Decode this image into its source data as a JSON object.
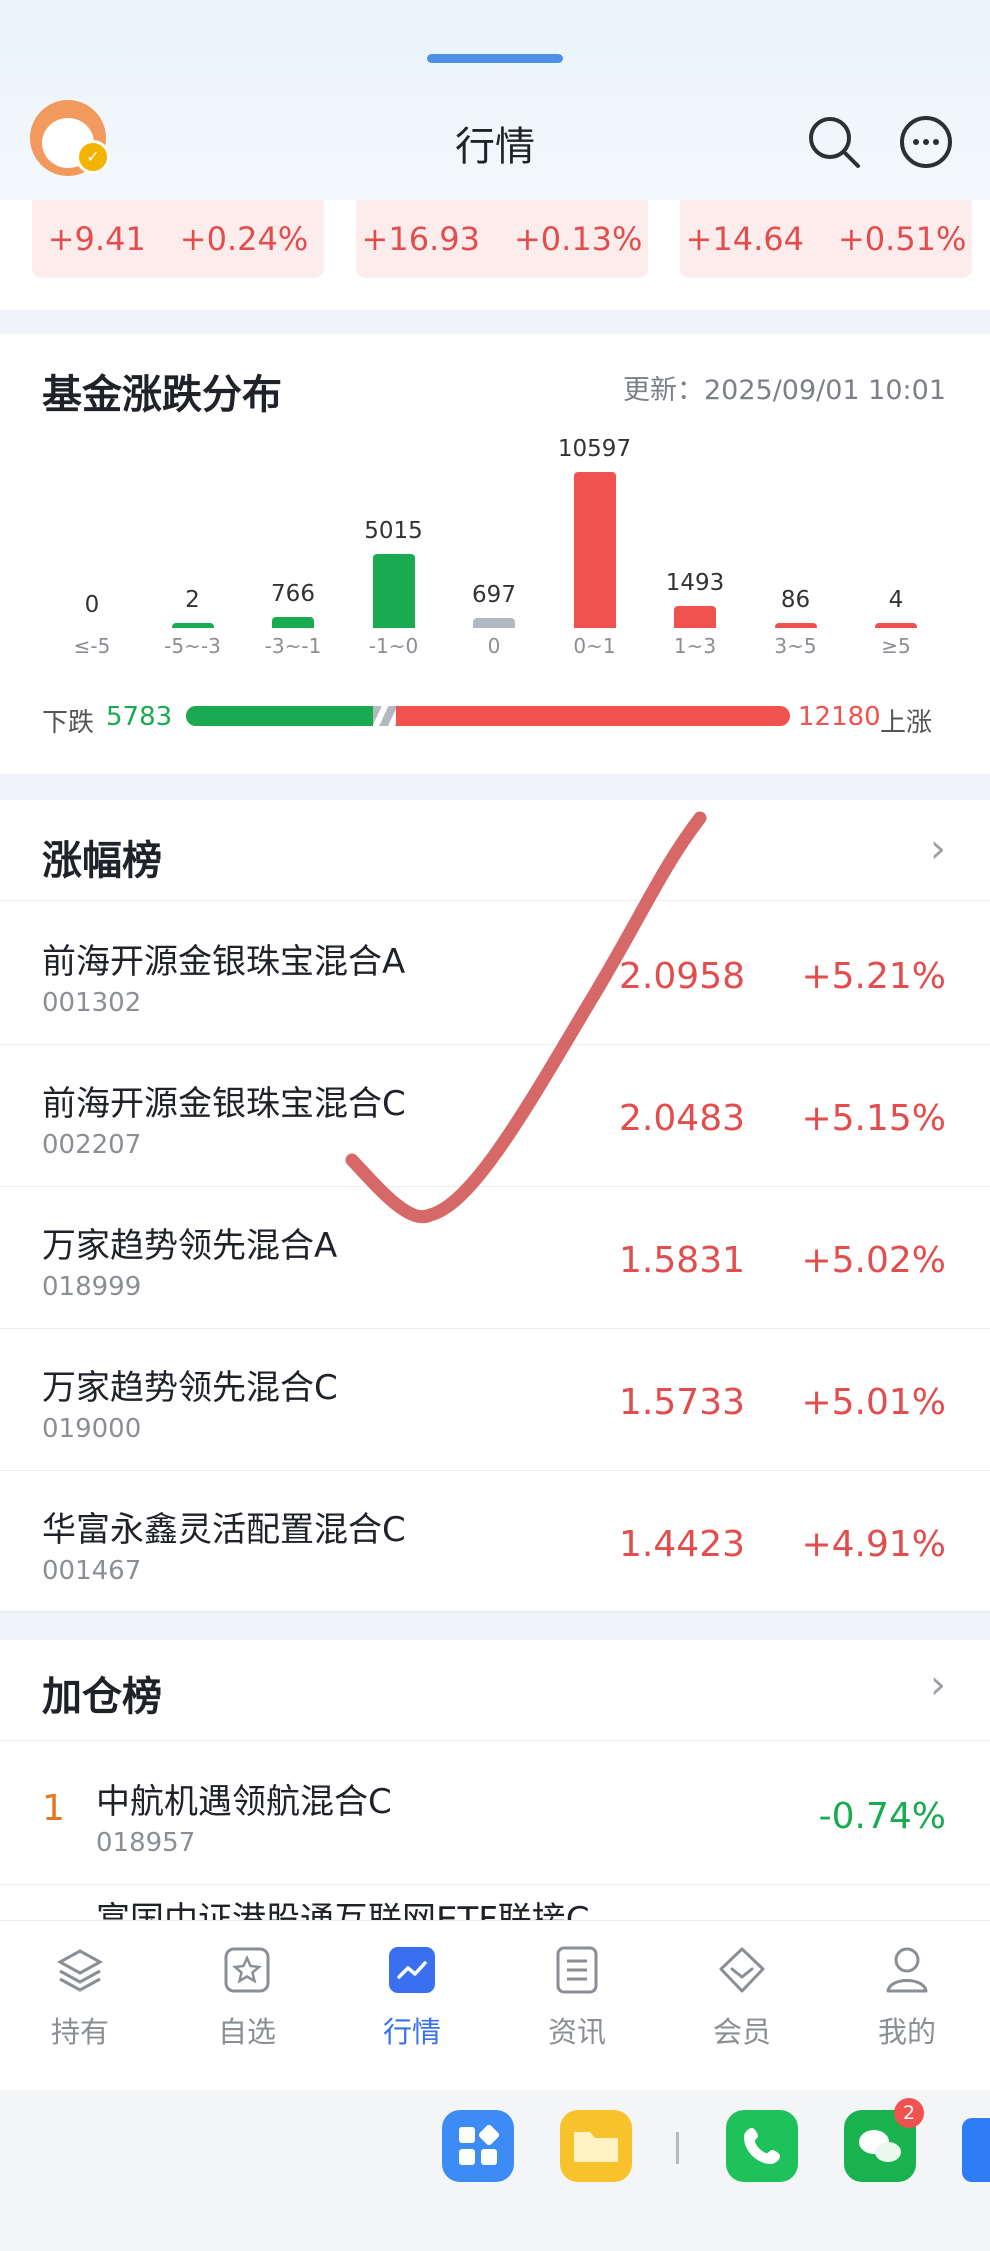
{
  "header": {
    "title": "行情"
  },
  "indices": [
    {
      "change": "+9.41",
      "pct": "+0.24%"
    },
    {
      "change": "+16.93",
      "pct": "+0.13%"
    },
    {
      "change": "+14.64",
      "pct": "+0.51%"
    }
  ],
  "distribution": {
    "title": "基金涨跌分布",
    "updated": "更新：2025/09/01 10:01",
    "down_label": "下跌",
    "down_count": "5783",
    "up_label": "上涨",
    "up_count": "12180",
    "colors": {
      "down": "#1aab52",
      "flat": "#b3b9c2",
      "up": "#f0524f"
    }
  },
  "chart_data": {
    "type": "bar",
    "categories": [
      "≤-5",
      "-5~-3",
      "-3~-1",
      "-1~0",
      "0",
      "0~1",
      "1~3",
      "3~5",
      "≥5"
    ],
    "values": [
      0,
      2,
      766,
      5015,
      697,
      10597,
      1493,
      86,
      4
    ],
    "value_labels": [
      "0",
      "2",
      "766",
      "5015",
      "697",
      "10597",
      "1493",
      "86",
      "4"
    ],
    "bar_colors": [
      "#1aab52",
      "#1aab52",
      "#1aab52",
      "#1aab52",
      "#b3b9c2",
      "#f0524f",
      "#f0524f",
      "#f0524f",
      "#f0524f"
    ],
    "title": "",
    "xlabel": "",
    "ylabel": ""
  },
  "gainers": {
    "title": "涨幅榜",
    "rows": [
      {
        "name": "前海开源金银珠宝混合A",
        "code": "001302",
        "nav": "2.0958",
        "pct": "+5.21%"
      },
      {
        "name": "前海开源金银珠宝混合C",
        "code": "002207",
        "nav": "2.0483",
        "pct": "+5.15%"
      },
      {
        "name": "万家趋势领先混合A",
        "code": "018999",
        "nav": "1.5831",
        "pct": "+5.02%"
      },
      {
        "name": "万家趋势领先混合C",
        "code": "019000",
        "nav": "1.5733",
        "pct": "+5.01%"
      },
      {
        "name": "华富永鑫灵活配置混合C",
        "code": "001467",
        "nav": "1.4423",
        "pct": "+4.91%"
      }
    ]
  },
  "adds": {
    "title": "加仓榜",
    "rows": [
      {
        "rank": "1",
        "name": "中航机遇领航混合C",
        "code": "018957",
        "pct": "-0.74%"
      },
      {
        "rank": "",
        "name": "富国中证港股通互联网ETF联接C",
        "code": "",
        "pct": ""
      }
    ]
  },
  "tabs": [
    {
      "label": "持有",
      "icon": "layers-icon"
    },
    {
      "label": "自选",
      "icon": "star-icon"
    },
    {
      "label": "行情",
      "icon": "chart-icon",
      "active": true
    },
    {
      "label": "资讯",
      "icon": "news-icon"
    },
    {
      "label": "会员",
      "icon": "diamond-icon"
    },
    {
      "label": "我的",
      "icon": "person-icon"
    }
  ],
  "dock": {
    "wechat_badge": "2"
  }
}
